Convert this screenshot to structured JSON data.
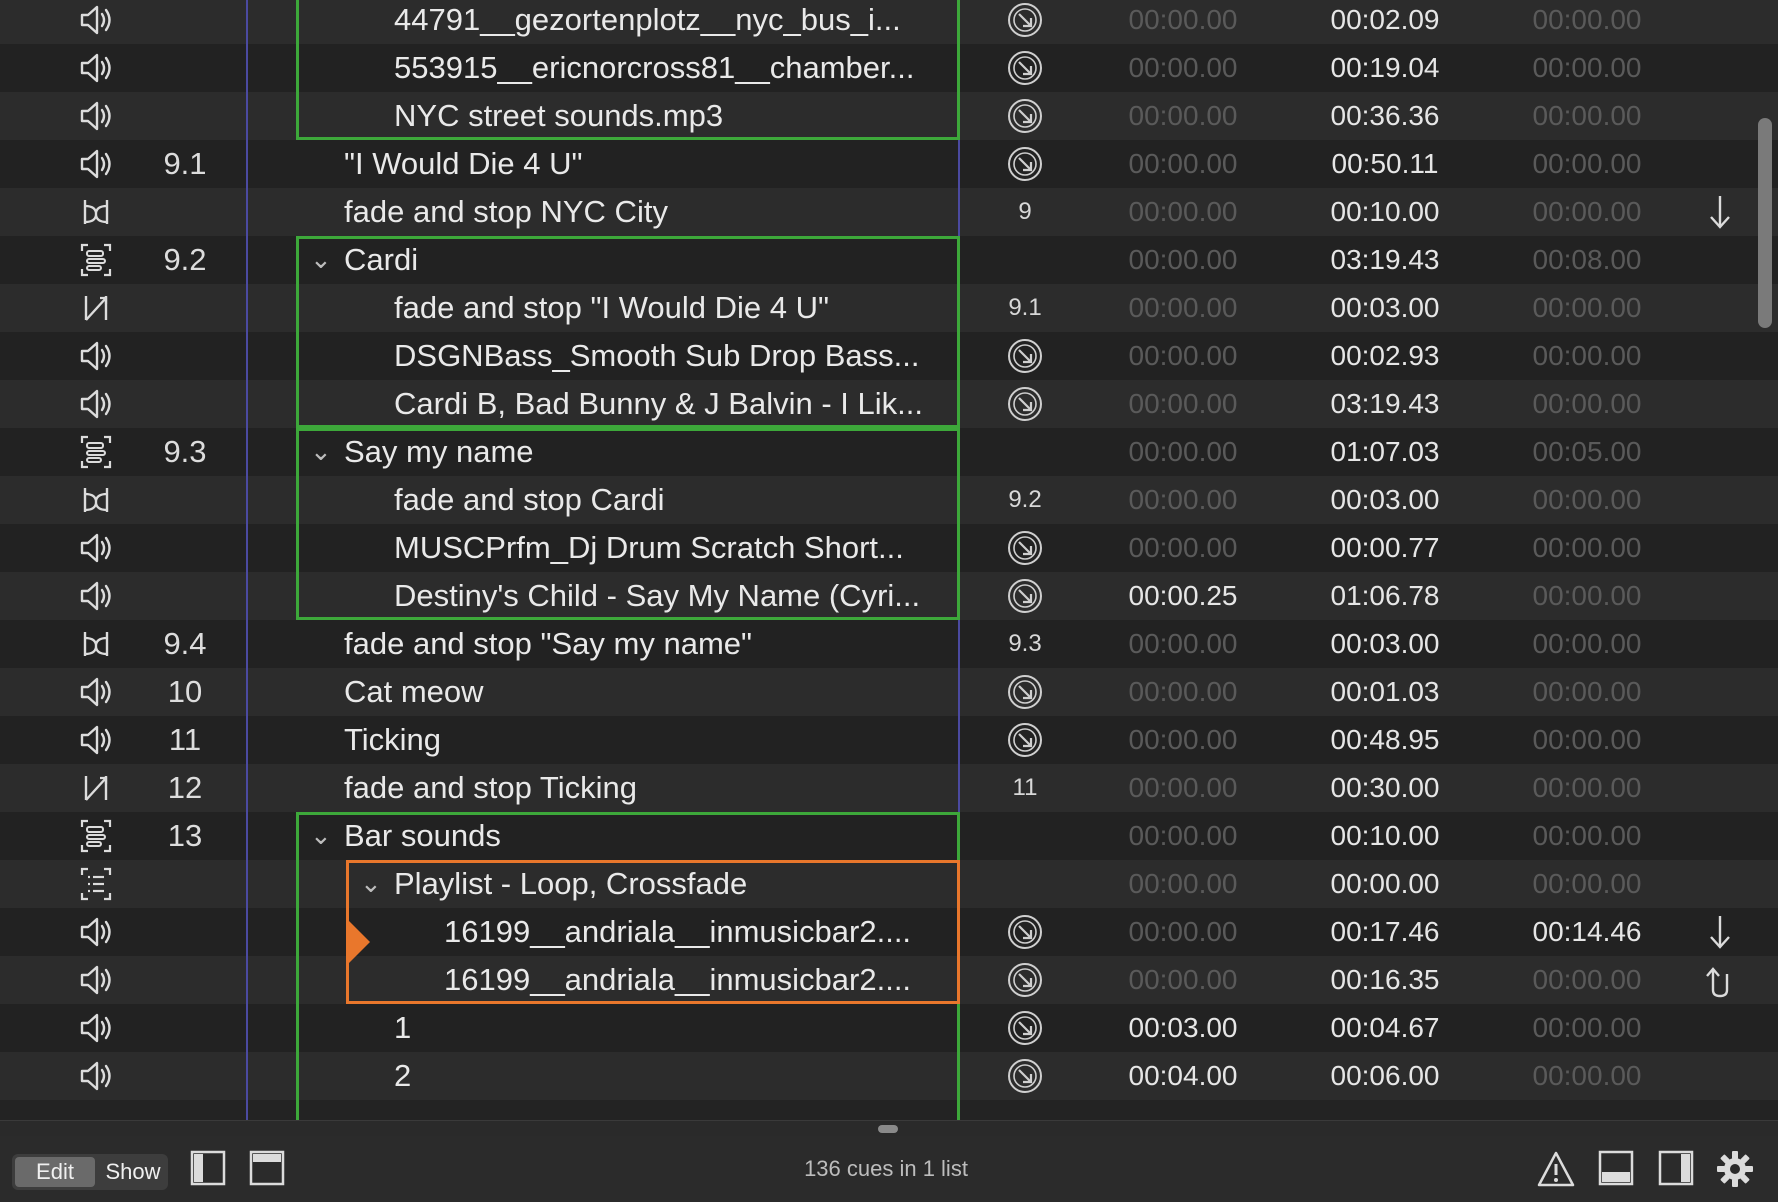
{
  "colors": {
    "group_outline": "#3da83a",
    "playlist_outline": "#e9772c",
    "playhead": "#e9772c",
    "column_divider": "#4b4aa0"
  },
  "rows": [
    {
      "icon": "audio-icon",
      "number": "",
      "name": "44791__gezortenplotz__nyc_bus_i...",
      "level": 2,
      "target": "target-circle-icon",
      "pre": "00:00.00",
      "action": "00:02.09",
      "post": "00:00.00"
    },
    {
      "icon": "audio-icon",
      "number": "",
      "name": "553915__ericnorcross81__chamber...",
      "level": 2,
      "target": "target-circle-icon",
      "pre": "00:00.00",
      "action": "00:19.04",
      "post": "00:00.00"
    },
    {
      "icon": "audio-icon",
      "number": "",
      "name": "NYC street sounds.mp3",
      "level": 2,
      "target": "target-circle-icon",
      "pre": "00:00.00",
      "action": "00:36.36",
      "post": "00:00.00"
    },
    {
      "icon": "audio-icon",
      "number": "9.1",
      "name": "\"I Would Die 4 U\"",
      "level": 1,
      "target": "target-circle-icon",
      "pre": "00:00.00",
      "action": "00:50.11",
      "post": "00:00.00"
    },
    {
      "icon": "fade-stop-icon",
      "number": "",
      "name": "fade and stop NYC City",
      "level": 1,
      "target_text": "9",
      "pre": "00:00.00",
      "action": "00:10.00",
      "post": "00:00.00",
      "cont": "auto-continue-icon"
    },
    {
      "icon": "group-icon",
      "number": "9.2",
      "name": "Cardi",
      "level": 1,
      "chevron": true,
      "pre": "00:00.00",
      "action": "03:19.43",
      "post": "00:08.00"
    },
    {
      "icon": "fade-icon",
      "number": "",
      "name": "fade and stop \"I Would Die 4 U\"",
      "level": 2,
      "target_text": "9.1",
      "pre": "00:00.00",
      "action": "00:03.00",
      "post": "00:00.00"
    },
    {
      "icon": "audio-icon",
      "number": "",
      "name": "DSGNBass_Smooth Sub Drop Bass...",
      "level": 2,
      "target": "target-circle-icon",
      "pre": "00:00.00",
      "action": "00:02.93",
      "post": "00:00.00"
    },
    {
      "icon": "audio-icon",
      "number": "",
      "name": "Cardi B, Bad Bunny & J Balvin - I Lik...",
      "level": 2,
      "target": "target-circle-icon",
      "pre": "00:00.00",
      "action": "03:19.43",
      "post": "00:00.00"
    },
    {
      "icon": "group-icon",
      "number": "9.3",
      "name": "Say my name",
      "level": 1,
      "chevron": true,
      "pre": "00:00.00",
      "action": "01:07.03",
      "post": "00:05.00"
    },
    {
      "icon": "fade-stop-icon",
      "number": "",
      "name": "fade and stop Cardi",
      "level": 2,
      "target_text": "9.2",
      "pre": "00:00.00",
      "action": "00:03.00",
      "post": "00:00.00"
    },
    {
      "icon": "audio-icon",
      "number": "",
      "name": "MUSCPrfm_Dj Drum Scratch Short...",
      "level": 2,
      "target": "target-circle-icon",
      "pre": "00:00.00",
      "action": "00:00.77",
      "post": "00:00.00"
    },
    {
      "icon": "audio-icon",
      "number": "",
      "name": "Destiny's Child - Say My Name (Cyri...",
      "level": 2,
      "target": "target-circle-icon",
      "pre": "00:00.25",
      "pre_active": true,
      "action": "01:06.78",
      "post": "00:00.00"
    },
    {
      "icon": "fade-stop-icon",
      "number": "9.4",
      "name": "fade and stop \"Say my name\"",
      "level": 1,
      "target_text": "9.3",
      "pre": "00:00.00",
      "action": "00:03.00",
      "post": "00:00.00"
    },
    {
      "icon": "audio-icon",
      "number": "10",
      "name": "Cat meow",
      "level": 1,
      "target": "target-circle-icon",
      "pre": "00:00.00",
      "action": "00:01.03",
      "post": "00:00.00"
    },
    {
      "icon": "audio-icon",
      "number": "11",
      "name": "Ticking",
      "level": 1,
      "target": "target-circle-icon",
      "pre": "00:00.00",
      "action": "00:48.95",
      "post": "00:00.00"
    },
    {
      "icon": "fade-icon",
      "number": "12",
      "name": "fade and stop Ticking",
      "level": 1,
      "target_text": "11",
      "pre": "00:00.00",
      "action": "00:30.00",
      "post": "00:00.00"
    },
    {
      "icon": "group-icon",
      "number": "13",
      "name": "Bar sounds",
      "level": 1,
      "chevron": true,
      "pre": "00:00.00",
      "action": "00:10.00",
      "post": "00:00.00"
    },
    {
      "icon": "playlist-icon",
      "number": "",
      "name": "Playlist - Loop, Crossfade",
      "level": 2,
      "chevron": true,
      "pre": "00:00.00",
      "action": "00:00.00",
      "post": "00:00.00"
    },
    {
      "icon": "audio-icon",
      "number": "",
      "name": "16199__andriala__inmusicbar2....",
      "level": 3,
      "target": "target-circle-icon",
      "pre": "00:00.00",
      "action": "00:17.46",
      "post": "00:14.46",
      "post_active": true,
      "cont": "auto-continue-icon"
    },
    {
      "icon": "audio-icon",
      "number": "",
      "name": "16199__andriala__inmusicbar2....",
      "level": 3,
      "target": "target-circle-icon",
      "pre": "00:00.00",
      "action": "00:16.35",
      "post": "00:00.00",
      "cont": "loop-return-icon"
    },
    {
      "icon": "audio-icon",
      "number": "",
      "name": "1",
      "level": 2,
      "target": "target-circle-icon",
      "pre": "00:03.00",
      "pre_active": true,
      "action": "00:04.67",
      "post": "00:00.00"
    },
    {
      "icon": "audio-icon",
      "number": "",
      "name": "2",
      "level": 2,
      "target": "target-circle-icon",
      "pre": "00:04.00",
      "pre_active": true,
      "action": "00:06.00",
      "post": "00:00.00"
    }
  ],
  "footer": {
    "edit_label": "Edit",
    "show_label": "Show",
    "status": "136 cues in 1 list",
    "icons": [
      "sidebar-left-icon",
      "inspector-top-icon",
      "warning-icon",
      "bottom-panel-icon",
      "right-panel-icon",
      "gear-icon"
    ]
  }
}
